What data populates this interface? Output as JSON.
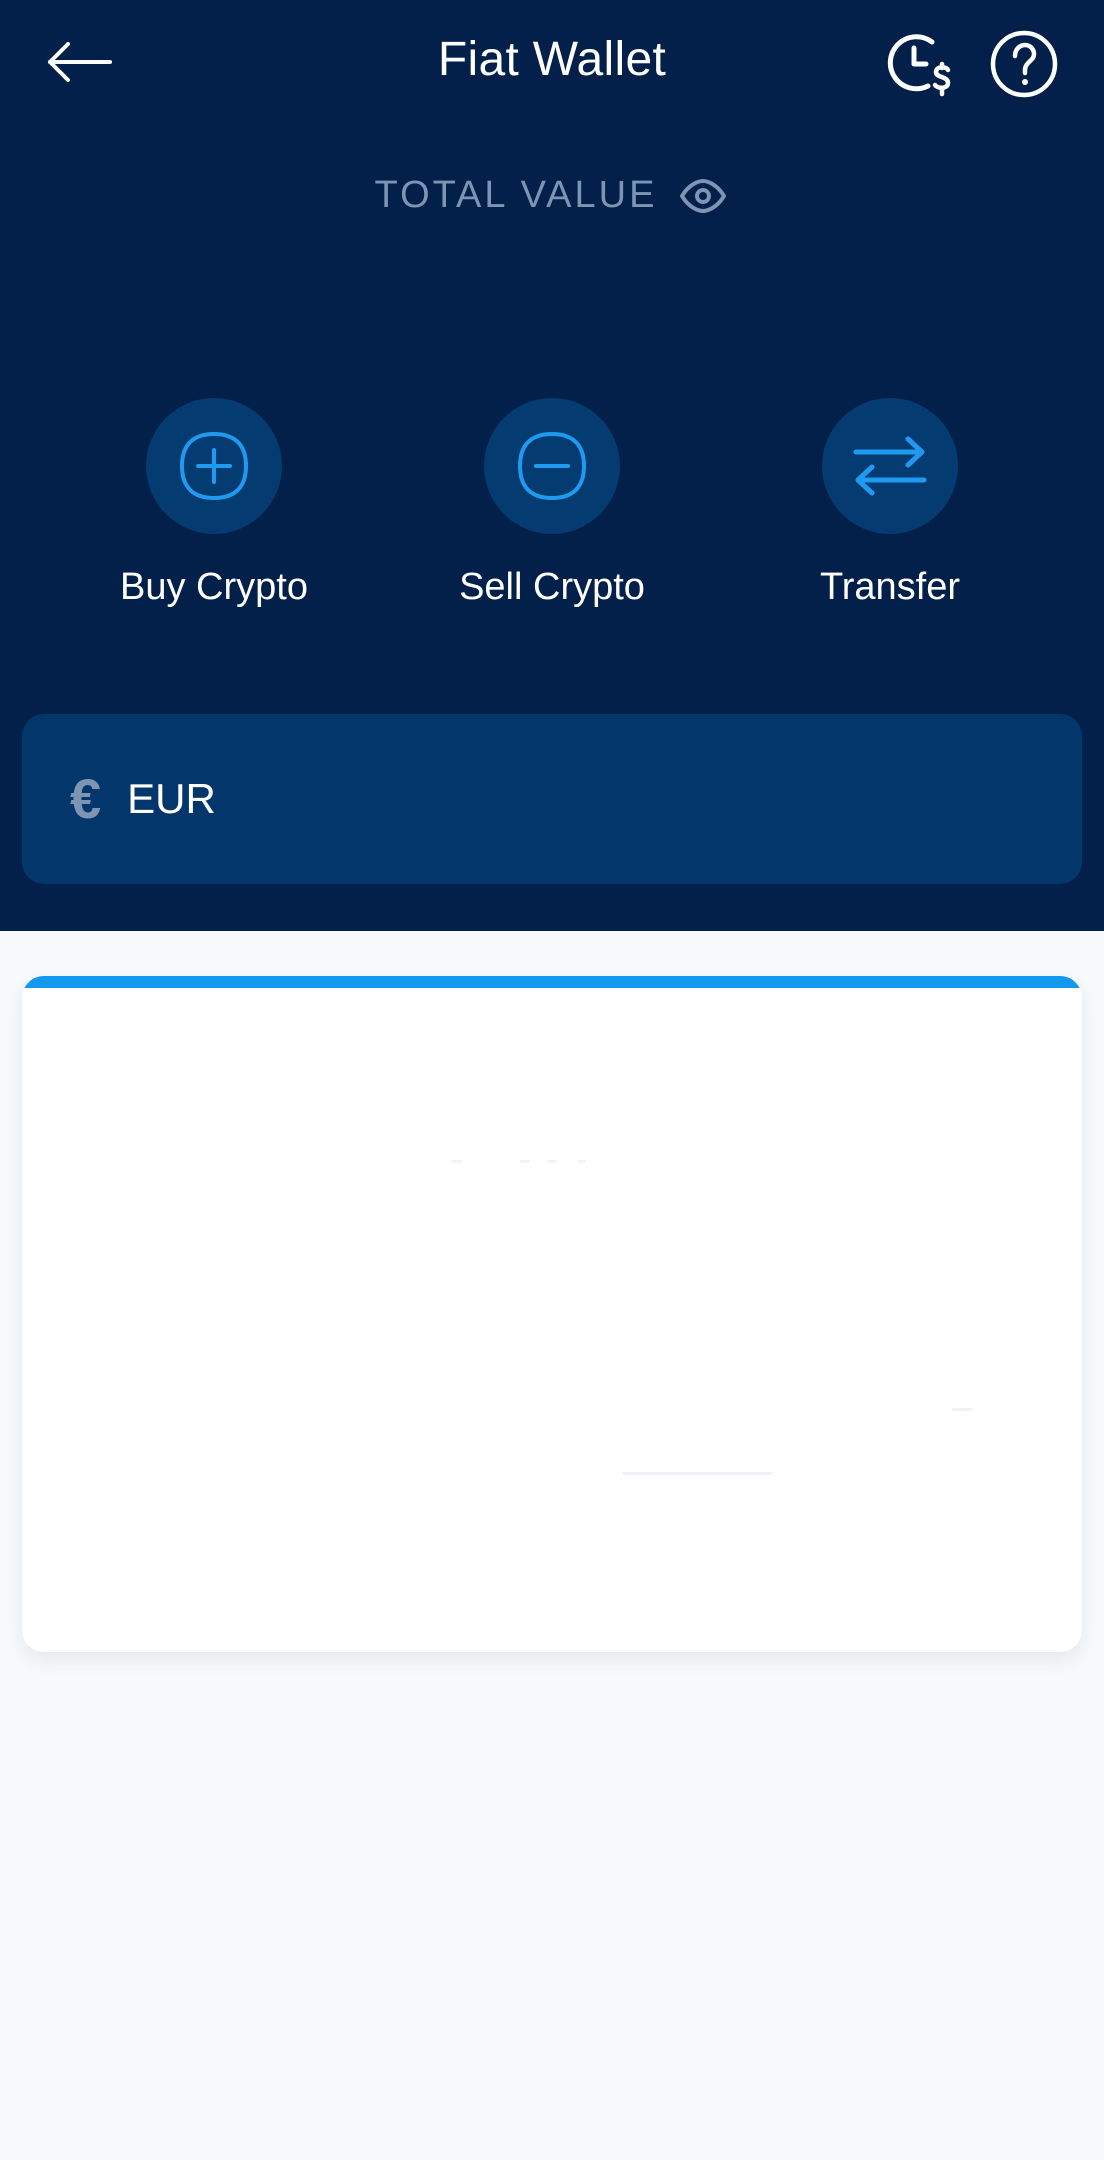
{
  "header": {
    "title": "Fiat Wallet",
    "back_icon": "arrow-left-icon",
    "history_icon": "clock-dollar-icon",
    "help_icon": "question-circle-icon"
  },
  "balance": {
    "label": "TOTAL VALUE",
    "visibility_icon": "eye-icon",
    "value": ""
  },
  "actions": [
    {
      "label": "Buy Crypto",
      "icon": "plus-circle-icon"
    },
    {
      "label": "Sell Crypto",
      "icon": "minus-circle-icon"
    },
    {
      "label": "Transfer",
      "icon": "swap-arrows-icon"
    }
  ],
  "currency": {
    "symbol": "€",
    "code": "EUR"
  },
  "colors": {
    "header_bg": "#02204a",
    "accent": "#1399ef",
    "muted_text": "#7d95b3",
    "card_bg": "#03366a",
    "page_bg": "#f7f9fb"
  }
}
